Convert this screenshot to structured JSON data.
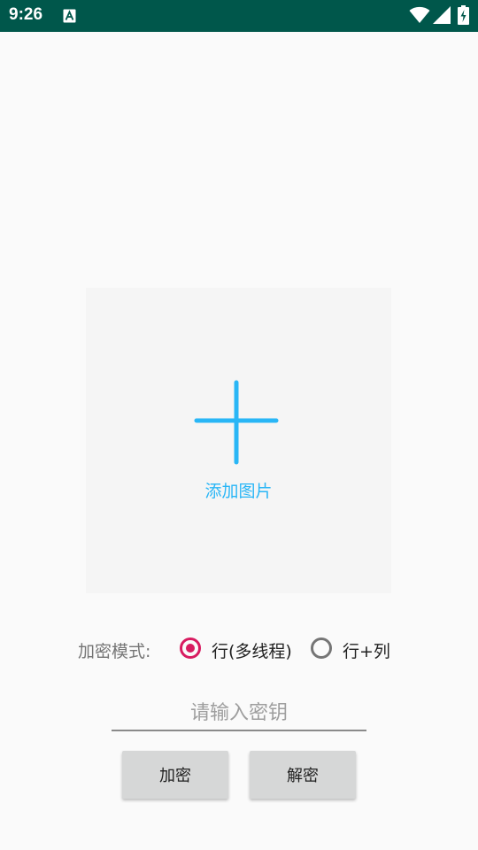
{
  "status_bar": {
    "time": "9:26",
    "icons": [
      "app-notification-icon",
      "wifi-icon",
      "signal-icon",
      "battery-charging-icon"
    ]
  },
  "image_picker": {
    "label": "添加图片",
    "icon": "plus-icon",
    "accent_color": "#29b6f6"
  },
  "mode": {
    "label": "加密模式:",
    "options": [
      {
        "label": "行(多线程)",
        "checked": true
      },
      {
        "label": "行+列",
        "checked": false
      }
    ],
    "checked_color": "#d81b60"
  },
  "key_input": {
    "placeholder": "请输入密钥",
    "value": ""
  },
  "buttons": {
    "encrypt_label": "加密",
    "decrypt_label": "解密"
  },
  "colors": {
    "status_bar": "#00574b",
    "background": "#fafafa"
  }
}
